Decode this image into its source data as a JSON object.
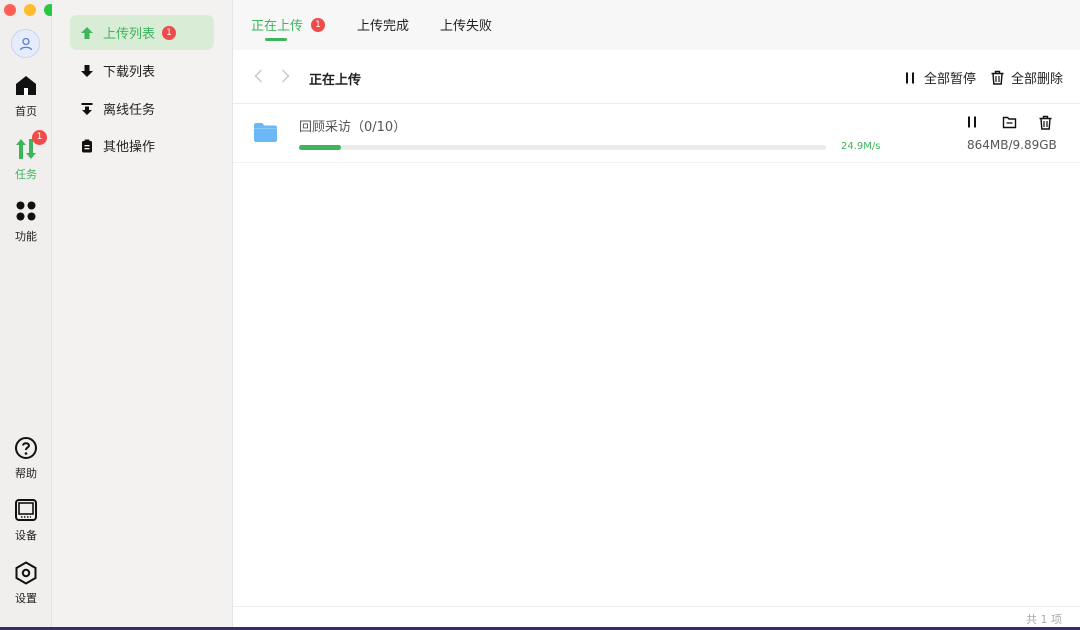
{
  "rail": {
    "items": [
      {
        "label": "首页",
        "icon": "home-icon"
      },
      {
        "label": "任务",
        "icon": "transfer-icon",
        "badge": "1"
      },
      {
        "label": "功能",
        "icon": "apps-icon"
      },
      {
        "label": "帮助",
        "icon": "help-icon"
      },
      {
        "label": "设备",
        "icon": "device-icon"
      },
      {
        "label": "设置",
        "icon": "settings-icon"
      }
    ]
  },
  "sidebar": {
    "items": [
      {
        "label": "上传列表",
        "icon": "upload-icon",
        "badge": "1"
      },
      {
        "label": "下载列表",
        "icon": "download-icon"
      },
      {
        "label": "离线任务",
        "icon": "offline-download-icon"
      },
      {
        "label": "其他操作",
        "icon": "clipboard-icon"
      }
    ]
  },
  "tabs": [
    {
      "label": "正在上传",
      "badge": "1"
    },
    {
      "label": "上传完成"
    },
    {
      "label": "上传失败"
    }
  ],
  "toolbar": {
    "title": "正在上传",
    "pause_all": "全部暂停",
    "delete_all": "全部删除"
  },
  "task": {
    "name": "回顾采访（0/10）",
    "progress": 0.08,
    "speed": "24.9M/s",
    "size": "864MB/9.89GB"
  },
  "footer": {
    "count": "共 1 项"
  },
  "colors": {
    "accent": "#3db55c",
    "badge": "#ef4b4b",
    "folder": "#6ab8f5"
  }
}
